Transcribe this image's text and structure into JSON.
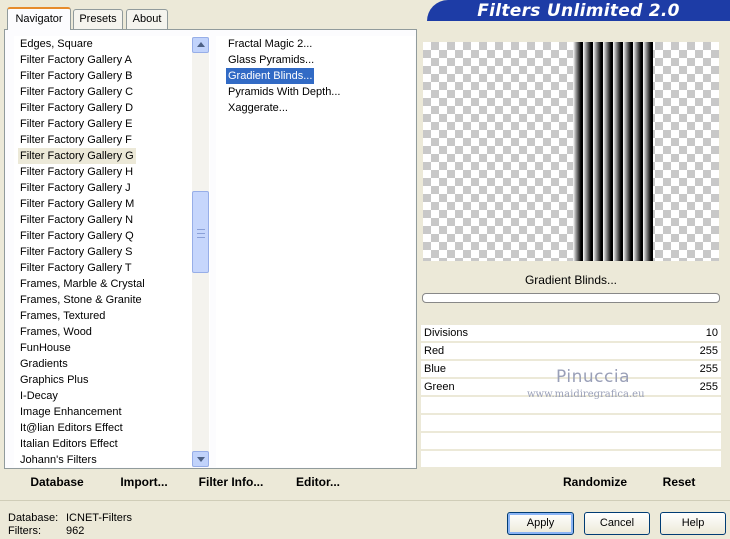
{
  "window": {
    "title": "Filters Unlimited 2.0"
  },
  "tabs": [
    {
      "label": "Navigator",
      "active": true
    },
    {
      "label": "Presets",
      "active": false
    },
    {
      "label": "About",
      "active": false
    }
  ],
  "categories": {
    "items": [
      "Edges, Square",
      "Filter Factory Gallery A",
      "Filter Factory Gallery B",
      "Filter Factory Gallery C",
      "Filter Factory Gallery D",
      "Filter Factory Gallery E",
      "Filter Factory Gallery F",
      "Filter Factory Gallery G",
      "Filter Factory Gallery H",
      "Filter Factory Gallery J",
      "Filter Factory Gallery M",
      "Filter Factory Gallery N",
      "Filter Factory Gallery Q",
      "Filter Factory Gallery S",
      "Filter Factory Gallery T",
      "Frames, Marble & Crystal",
      "Frames, Stone & Granite",
      "Frames, Textured",
      "Frames, Wood",
      "FunHouse",
      "Gradients",
      "Graphics Plus",
      "I-Decay",
      "Image Enhancement",
      "It@lian Editors Effect",
      "Italian Editors Effect",
      "Johann's Filters"
    ],
    "selected_index": 7
  },
  "filters": {
    "items": [
      "Fractal Magic 2...",
      "Glass Pyramids...",
      "Gradient Blinds...",
      "Pyramids With Depth...",
      "Xaggerate..."
    ],
    "selected_index": 2
  },
  "preview": {
    "filter_name": "Gradient Blinds..."
  },
  "params": [
    {
      "label": "Divisions",
      "value": "10"
    },
    {
      "label": "Red",
      "value": "255"
    },
    {
      "label": "Blue",
      "value": "255"
    },
    {
      "label": "Green",
      "value": "255"
    }
  ],
  "watermark": {
    "line1": "Pinuccia",
    "line2": "www.maidiregrafica.eu"
  },
  "toolbar": {
    "database": "Database",
    "import": "Import...",
    "filter_info": "Filter Info...",
    "editor": "Editor...",
    "randomize": "Randomize",
    "reset": "Reset"
  },
  "status": {
    "database_label": "Database:",
    "database_value": "ICNET-Filters",
    "filters_label": "Filters:",
    "filters_value": "962"
  },
  "buttons": {
    "apply": "Apply",
    "cancel": "Cancel",
    "help": "Help"
  },
  "colors": {
    "banner": "#1d3ca6",
    "selection": "#316ac5",
    "tab_accent": "#e68b2c"
  }
}
